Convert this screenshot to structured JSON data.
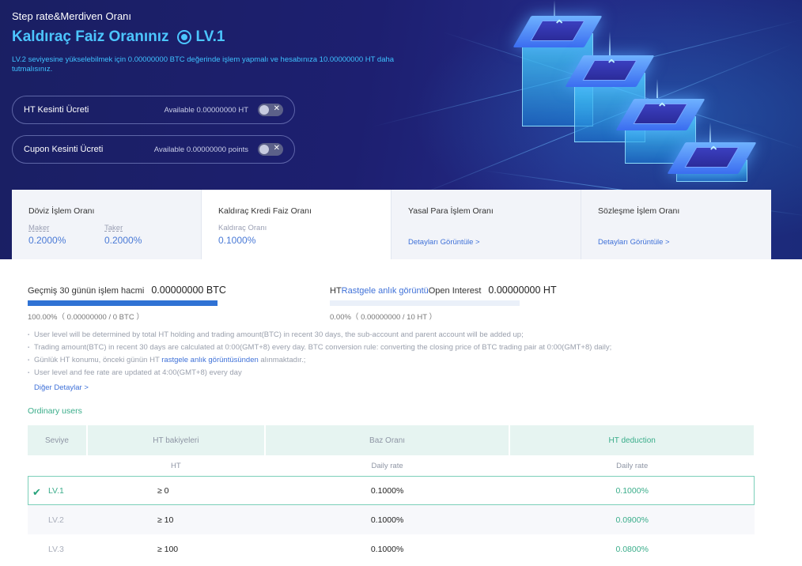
{
  "hero": {
    "tagline": "Step rate&Merdiven Oranı",
    "title": "Kaldıraç Faiz Oranınız",
    "level": "LV.1",
    "description": "LV.2 seviyesine yükselebilmek için 0.00000000 BTC değerinde işlem yapmalı ve hesabınıza 10.00000000 HT daha tutmalısınız.",
    "toggles": [
      {
        "label": "HT Kesinti Ücreti",
        "available": "Available 0.00000000 HT"
      },
      {
        "label": "Cupon Kesinti Ücreti",
        "available": "Available 0.00000000 points"
      }
    ],
    "toggle_close": "✕",
    "colors": {
      "accent": "#4cc6ff",
      "background": "#1d1f70"
    }
  },
  "tabs": [
    {
      "title": "Döviz İşlem Oranı",
      "sub": [
        {
          "label": "Maker",
          "value": "0.2000%"
        },
        {
          "label": "Taker",
          "value": "0.2000%"
        }
      ]
    },
    {
      "title": "Kaldıraç Kredi Faiz Oranı",
      "sub": [
        {
          "label": "Kaldıraç Oranı",
          "value": "0.1000%"
        }
      ]
    },
    {
      "title": "Yasal Para İşlem Oranı",
      "link": "Detayları Görüntüle >"
    },
    {
      "title": "Sözleşme İşlem Oranı",
      "link": "Detayları Görüntüle >"
    }
  ],
  "volume": {
    "label": "Geçmiş 30 günün işlem hacmi",
    "value": "0.00000000 BTC",
    "progress": 1.0,
    "percent_text": "100.00%（ 0.00000000 / 0 BTC ）"
  },
  "holding": {
    "prefix": "HT",
    "link": "Rastgele anlık görüntü",
    "suffix": "Open Interest",
    "value": "0.00000000 HT",
    "progress": 0.0,
    "percent_text": "0.00%（ 0.00000000 / 10 HT ）"
  },
  "notes": [
    {
      "text": "User level will be determined by total HT holding and trading amount(BTC) in recent 30 days, the sub-account and parent account will be added up;"
    },
    {
      "text": "Trading amount(BTC) in recent 30 days are calculated at 0:00(GMT+8) every day. BTC conversion rule: converting the closing price of BTC trading pair at 0:00(GMT+8) daily;"
    },
    {
      "pre": "Günlük HT konumu, önceki günün HT ",
      "link": "rastgele anlık görüntüsünden",
      "post": " alınmaktadır.;"
    },
    {
      "text": "User level and fee rate are updated at 4:00(GMT+8) every day"
    }
  ],
  "more_link": "Diğer Detaylar >",
  "section_title": "Ordinary users",
  "table": {
    "headers": [
      "Seviye",
      "HT bakiyeleri",
      "Baz Oranı",
      "HT deduction"
    ],
    "subheaders": [
      "",
      "HT",
      "Daily rate",
      "Daily rate"
    ],
    "rows": [
      {
        "level": "LV.1",
        "ht": "≥ 0",
        "base": "0.1000%",
        "deduction": "0.1000%",
        "current": true
      },
      {
        "level": "LV.2",
        "ht": "≥ 10",
        "base": "0.1000%",
        "deduction": "0.0900%"
      },
      {
        "level": "LV.3",
        "ht": "≥ 100",
        "base": "0.1000%",
        "deduction": "0.0800%"
      }
    ],
    "current_mark": "✔"
  }
}
